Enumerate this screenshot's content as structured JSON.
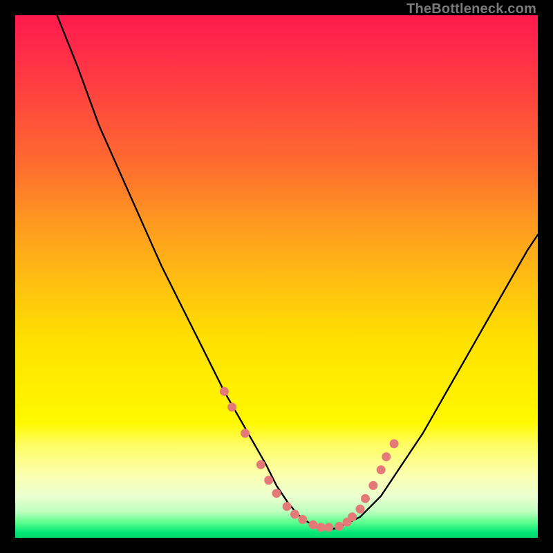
{
  "watermark": "TheBottleneck.com",
  "chart_data": {
    "type": "line",
    "title": "",
    "xlabel": "",
    "ylabel": "",
    "xlim": [
      0,
      100
    ],
    "ylim": [
      0,
      100
    ],
    "series": [
      {
        "name": "curve",
        "x": [
          8,
          12,
          16,
          20,
          24,
          28,
          32,
          36,
          40,
          44,
          48,
          50,
          52,
          54,
          56,
          58,
          60,
          62,
          66,
          70,
          74,
          78,
          82,
          86,
          90,
          94,
          98,
          100
        ],
        "y": [
          100,
          90,
          79,
          70,
          61,
          52,
          44,
          36,
          28,
          21,
          14,
          10,
          7,
          4.5,
          3,
          2,
          1.5,
          2,
          4,
          8,
          14,
          20,
          27,
          34,
          41,
          48,
          55,
          58
        ]
      }
    ],
    "scatter": {
      "name": "dots",
      "color": "#e47a77",
      "x": [
        40,
        41.5,
        44,
        47,
        48.5,
        50,
        52,
        53.5,
        55,
        57,
        58.5,
        60,
        62,
        63.5,
        64.5,
        66,
        67,
        68.5,
        70,
        71,
        72.5
      ],
      "y": [
        28,
        25,
        20,
        14,
        11,
        8.5,
        6,
        4.5,
        3.5,
        2.5,
        2,
        2,
        2.2,
        3,
        4,
        5.5,
        7.5,
        10,
        13,
        15.5,
        18
      ]
    },
    "background_gradient": {
      "top": "#ff1a4d",
      "middle": "#ffe000",
      "bottom": "#00d868"
    }
  }
}
